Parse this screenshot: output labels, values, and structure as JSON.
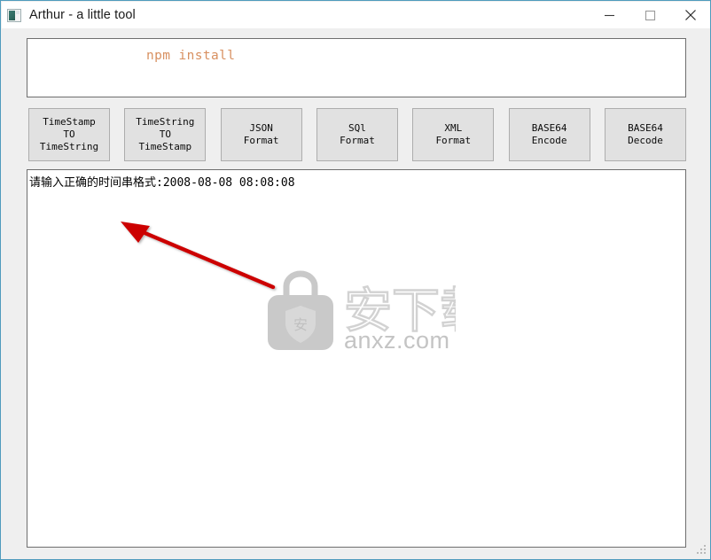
{
  "window": {
    "title": "Arthur - a little tool",
    "icon": "app-window-icon",
    "border_color": "#4f9bbd",
    "background": "#efefef",
    "controls": {
      "minimize": "minimize-icon",
      "maximize": "maximize-icon",
      "close": "close-icon"
    }
  },
  "input": {
    "value": "npm install",
    "text_color": "#d89060"
  },
  "buttons": [
    {
      "name": "timestamp-to-timestring",
      "lines": [
        "TimeStamp",
        "TO",
        "TimeString"
      ]
    },
    {
      "name": "timestring-to-timestamp",
      "lines": [
        "TimeString",
        "TO",
        "TimeStamp"
      ]
    },
    {
      "name": "json-format",
      "lines": [
        "JSON",
        "Format"
      ]
    },
    {
      "name": "sql-format",
      "lines": [
        "SQl",
        "Format"
      ]
    },
    {
      "name": "xml-format",
      "lines": [
        "XML",
        "Format"
      ]
    },
    {
      "name": "base64-encode",
      "lines": [
        "BASE64",
        "Encode"
      ]
    },
    {
      "name": "base64-decode",
      "lines": [
        "BASE64",
        "Decode"
      ]
    }
  ],
  "output": {
    "text": "请输入正确的时间串格式:2008-08-08 08:08:08"
  },
  "watermark": {
    "brand_cn": "安下载",
    "brand_url": "anxz.com",
    "logo_glyph": "安",
    "color": "#c9c9c9"
  },
  "annotation": {
    "type": "arrow",
    "color": "#cc0000",
    "points_to": "output-text"
  }
}
